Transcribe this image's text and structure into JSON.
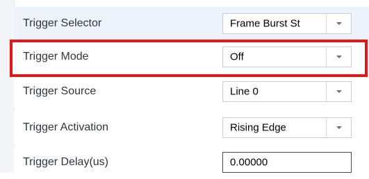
{
  "properties": [
    {
      "label": "Trigger Selector",
      "value": "Frame Burst St",
      "control": "dropdown"
    },
    {
      "label": "Trigger Mode",
      "value": "Off",
      "control": "dropdown"
    },
    {
      "label": "Trigger Source",
      "value": "Line 0",
      "control": "dropdown"
    },
    {
      "label": "Trigger Activation",
      "value": "Rising Edge",
      "control": "dropdown"
    },
    {
      "label": "Trigger Delay(us)",
      "value": "0.00000",
      "control": "textbox"
    }
  ],
  "highlight": {
    "target": "Trigger Mode",
    "color": "#e01818"
  },
  "colors": {
    "selected_row_bg": "#eef2fb",
    "label_text": "#2e3440",
    "value_text": "#000000"
  }
}
